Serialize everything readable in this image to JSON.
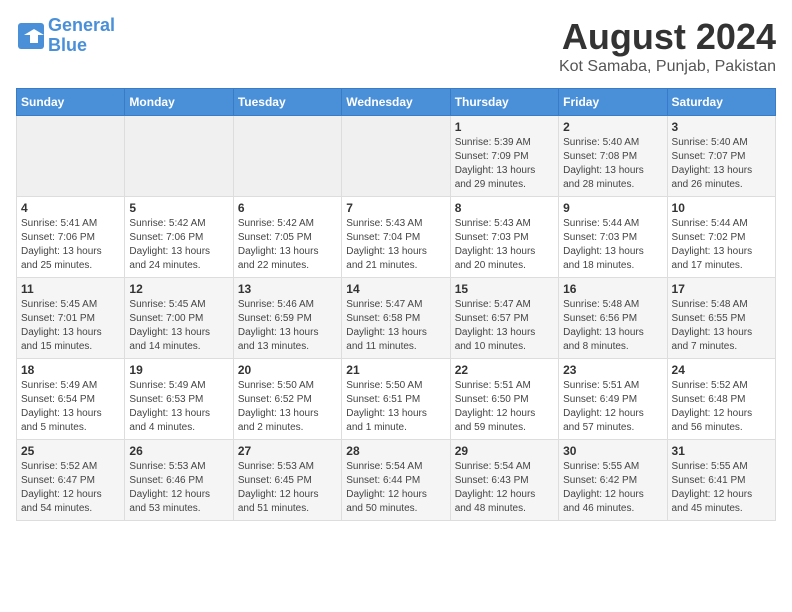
{
  "header": {
    "logo_line1": "General",
    "logo_line2": "Blue",
    "month": "August 2024",
    "location": "Kot Samaba, Punjab, Pakistan"
  },
  "days_of_week": [
    "Sunday",
    "Monday",
    "Tuesday",
    "Wednesday",
    "Thursday",
    "Friday",
    "Saturday"
  ],
  "weeks": [
    [
      {
        "day": "",
        "content": ""
      },
      {
        "day": "",
        "content": ""
      },
      {
        "day": "",
        "content": ""
      },
      {
        "day": "",
        "content": ""
      },
      {
        "day": "1",
        "content": "Sunrise: 5:39 AM\nSunset: 7:09 PM\nDaylight: 13 hours\nand 29 minutes."
      },
      {
        "day": "2",
        "content": "Sunrise: 5:40 AM\nSunset: 7:08 PM\nDaylight: 13 hours\nand 28 minutes."
      },
      {
        "day": "3",
        "content": "Sunrise: 5:40 AM\nSunset: 7:07 PM\nDaylight: 13 hours\nand 26 minutes."
      }
    ],
    [
      {
        "day": "4",
        "content": "Sunrise: 5:41 AM\nSunset: 7:06 PM\nDaylight: 13 hours\nand 25 minutes."
      },
      {
        "day": "5",
        "content": "Sunrise: 5:42 AM\nSunset: 7:06 PM\nDaylight: 13 hours\nand 24 minutes."
      },
      {
        "day": "6",
        "content": "Sunrise: 5:42 AM\nSunset: 7:05 PM\nDaylight: 13 hours\nand 22 minutes."
      },
      {
        "day": "7",
        "content": "Sunrise: 5:43 AM\nSunset: 7:04 PM\nDaylight: 13 hours\nand 21 minutes."
      },
      {
        "day": "8",
        "content": "Sunrise: 5:43 AM\nSunset: 7:03 PM\nDaylight: 13 hours\nand 20 minutes."
      },
      {
        "day": "9",
        "content": "Sunrise: 5:44 AM\nSunset: 7:03 PM\nDaylight: 13 hours\nand 18 minutes."
      },
      {
        "day": "10",
        "content": "Sunrise: 5:44 AM\nSunset: 7:02 PM\nDaylight: 13 hours\nand 17 minutes."
      }
    ],
    [
      {
        "day": "11",
        "content": "Sunrise: 5:45 AM\nSunset: 7:01 PM\nDaylight: 13 hours\nand 15 minutes."
      },
      {
        "day": "12",
        "content": "Sunrise: 5:45 AM\nSunset: 7:00 PM\nDaylight: 13 hours\nand 14 minutes."
      },
      {
        "day": "13",
        "content": "Sunrise: 5:46 AM\nSunset: 6:59 PM\nDaylight: 13 hours\nand 13 minutes."
      },
      {
        "day": "14",
        "content": "Sunrise: 5:47 AM\nSunset: 6:58 PM\nDaylight: 13 hours\nand 11 minutes."
      },
      {
        "day": "15",
        "content": "Sunrise: 5:47 AM\nSunset: 6:57 PM\nDaylight: 13 hours\nand 10 minutes."
      },
      {
        "day": "16",
        "content": "Sunrise: 5:48 AM\nSunset: 6:56 PM\nDaylight: 13 hours\nand 8 minutes."
      },
      {
        "day": "17",
        "content": "Sunrise: 5:48 AM\nSunset: 6:55 PM\nDaylight: 13 hours\nand 7 minutes."
      }
    ],
    [
      {
        "day": "18",
        "content": "Sunrise: 5:49 AM\nSunset: 6:54 PM\nDaylight: 13 hours\nand 5 minutes."
      },
      {
        "day": "19",
        "content": "Sunrise: 5:49 AM\nSunset: 6:53 PM\nDaylight: 13 hours\nand 4 minutes."
      },
      {
        "day": "20",
        "content": "Sunrise: 5:50 AM\nSunset: 6:52 PM\nDaylight: 13 hours\nand 2 minutes."
      },
      {
        "day": "21",
        "content": "Sunrise: 5:50 AM\nSunset: 6:51 PM\nDaylight: 13 hours\nand 1 minute."
      },
      {
        "day": "22",
        "content": "Sunrise: 5:51 AM\nSunset: 6:50 PM\nDaylight: 12 hours\nand 59 minutes."
      },
      {
        "day": "23",
        "content": "Sunrise: 5:51 AM\nSunset: 6:49 PM\nDaylight: 12 hours\nand 57 minutes."
      },
      {
        "day": "24",
        "content": "Sunrise: 5:52 AM\nSunset: 6:48 PM\nDaylight: 12 hours\nand 56 minutes."
      }
    ],
    [
      {
        "day": "25",
        "content": "Sunrise: 5:52 AM\nSunset: 6:47 PM\nDaylight: 12 hours\nand 54 minutes."
      },
      {
        "day": "26",
        "content": "Sunrise: 5:53 AM\nSunset: 6:46 PM\nDaylight: 12 hours\nand 53 minutes."
      },
      {
        "day": "27",
        "content": "Sunrise: 5:53 AM\nSunset: 6:45 PM\nDaylight: 12 hours\nand 51 minutes."
      },
      {
        "day": "28",
        "content": "Sunrise: 5:54 AM\nSunset: 6:44 PM\nDaylight: 12 hours\nand 50 minutes."
      },
      {
        "day": "29",
        "content": "Sunrise: 5:54 AM\nSunset: 6:43 PM\nDaylight: 12 hours\nand 48 minutes."
      },
      {
        "day": "30",
        "content": "Sunrise: 5:55 AM\nSunset: 6:42 PM\nDaylight: 12 hours\nand 46 minutes."
      },
      {
        "day": "31",
        "content": "Sunrise: 5:55 AM\nSunset: 6:41 PM\nDaylight: 12 hours\nand 45 minutes."
      }
    ]
  ]
}
